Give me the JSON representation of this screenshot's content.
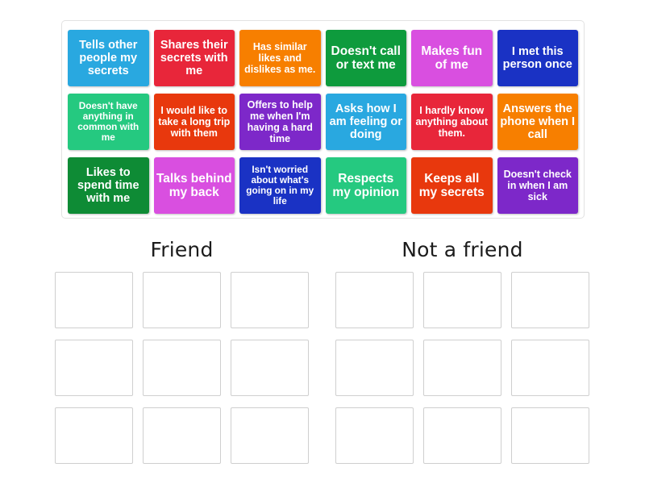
{
  "board": {
    "title": "Friend or Not a Friend sorting activity"
  },
  "tray": {
    "name": "tile-tray",
    "tiles": [
      {
        "text": "Tells other people my secrets",
        "color": "#29A8E0",
        "size": "t-md"
      },
      {
        "text": "Shares their secrets with me",
        "color": "#E8263A",
        "size": "t-md"
      },
      {
        "text": "Has similar likes and dislikes as me.",
        "color": "#F77F00",
        "size": "t-sm"
      },
      {
        "text": "Doesn't call or text me",
        "color": "#0E9B3D",
        "size": "t-lg"
      },
      {
        "text": "Makes fun of me",
        "color": "#D94FE0",
        "size": "t-lg"
      },
      {
        "text": "I met this person once",
        "color": "#1A32C4",
        "size": "t-md"
      },
      {
        "text": "Doesn't have anything in common with me",
        "color": "#25C980",
        "size": "t-xs"
      },
      {
        "text": "I would like to take a long trip with them",
        "color": "#E8380D",
        "size": "t-sm"
      },
      {
        "text": "Offers to help me when I'm having a hard time",
        "color": "#7D28C9",
        "size": "t-sm"
      },
      {
        "text": "Asks how I am feeling or doing",
        "color": "#29A8E0",
        "size": "t-md"
      },
      {
        "text": "I hardly know anything about them.",
        "color": "#E8263A",
        "size": "t-sm"
      },
      {
        "text": "Answers the phone when I call",
        "color": "#F77F00",
        "size": "t-md"
      },
      {
        "text": "Likes to spend time with me",
        "color": "#0E8B35",
        "size": "t-md"
      },
      {
        "text": "Talks behind my back",
        "color": "#D94FE0",
        "size": "t-lg"
      },
      {
        "text": "Isn't worried about what's going on in my life",
        "color": "#1A32C4",
        "size": "t-xs"
      },
      {
        "text": "Respects my opinion",
        "color": "#25C980",
        "size": "t-lg"
      },
      {
        "text": "Keeps all my secrets",
        "color": "#E8380D",
        "size": "t-lg"
      },
      {
        "text": "Doesn't check in when I am sick",
        "color": "#7D28C9",
        "size": "t-sm"
      }
    ]
  },
  "columns": [
    {
      "heading": "Friend",
      "slots": 9
    },
    {
      "heading": "Not a friend",
      "slots": 9
    }
  ],
  "colors": {
    "tray_border": "#e2e2e2",
    "slot_border": "#cfcfcf",
    "heading_text": "#1c1c1c",
    "page_background": "#ffffff"
  }
}
